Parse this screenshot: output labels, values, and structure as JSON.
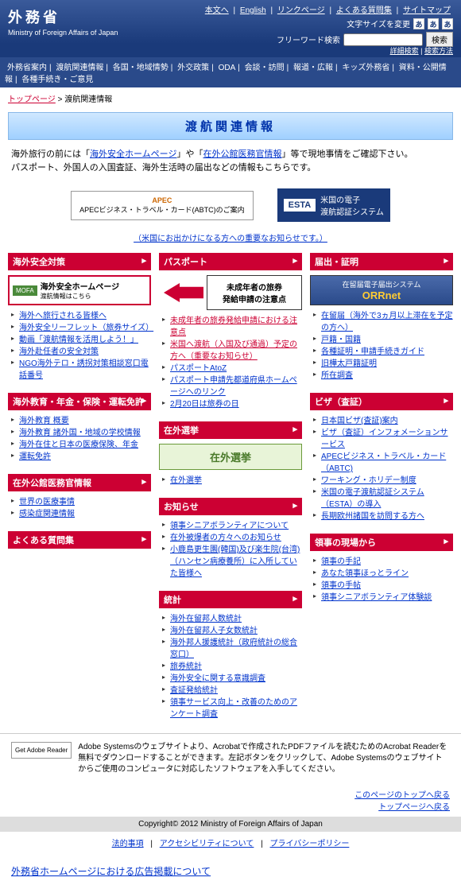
{
  "header": {
    "logo": "外務省",
    "logo_sub": "Ministry of Foreign Affairs of Japan",
    "top_links": [
      "本文へ",
      "English",
      "リンクページ",
      "よくある質問集",
      "サイトマップ"
    ],
    "font_label": "文字サイズを変更",
    "search_label": "フリーワード検索",
    "search_btn": "検索",
    "search_sub": [
      "詳細検索",
      "検索方法"
    ]
  },
  "nav": [
    "外務省案内",
    "渡航関連情報",
    "各国・地域情勢",
    "外交政策",
    "ODA",
    "会談・訪問",
    "報道・広報",
    "キッズ外務省",
    "資料・公開情報",
    "各種手続き・ご意見"
  ],
  "breadcrumb": {
    "home": "トップページ",
    "sep": " > ",
    "cur": "渡航関連情報"
  },
  "title": "渡航関連情報",
  "intro": {
    "l1a": "海外旅行の前には「",
    "l1b": "海外安全ホームページ",
    "l1c": "」や「",
    "l1d": "在外公館医務官情報",
    "l1e": "」等で現地事情をご確認下さい。",
    "l2": "パスポート、外国人の入国査証、海外生活時の届出などの情報もこちらです。"
  },
  "apec": {
    "t": "APEC",
    "s": "APECビジネス・トラベル・カード(ABTC)のご案内"
  },
  "esta": {
    "logo": "ESTA",
    "t1": "米国の電子",
    "t2": "渡航認証システム"
  },
  "notice_center": "（米国にお出かけになる方への重要なお知らせです。）",
  "cols": {
    "c1": {
      "s1": {
        "h": "海外安全対策",
        "box": {
          "tag": "MOFA",
          "t1": "海外安全ホームページ",
          "t2": "渡航情報はこちら"
        },
        "items": [
          "海外へ旅行される皆様へ",
          "海外安全リーフレット（旅券サイズ）",
          "動画「渡航情報を活用しよう！」",
          "海外赴任者の安全対策",
          "NGO海外テロ・誘拐対策相談窓口電話番号"
        ]
      },
      "s2": {
        "h": "海外教育・年金・保険・運転免許",
        "items": [
          "海外教育 概要",
          "海外教育 諸外国・地域の学校情報",
          "海外在住と日本の医療保険、年金",
          "運転免許"
        ]
      },
      "s3": {
        "h": "在外公館医務官情報",
        "items": [
          "世界の医療事情",
          "感染症関連情報"
        ]
      },
      "s4": {
        "h": "よくある質問集"
      }
    },
    "c2": {
      "s1": {
        "h": "パスポート",
        "box": {
          "t1": "未成年者の旅券",
          "t2": "発給申請の注意点"
        },
        "items": [
          {
            "t": "未成年者の旅券発給申請における注意点",
            "red": true
          },
          {
            "t": "米国へ渡航（入国及び通過）予定の方へ（重要なお知らせ）",
            "red": true
          },
          {
            "t": "パスポートAtoZ"
          },
          {
            "t": "パスポート申請先都道府県ホームページへのリンク"
          },
          {
            "t": "2月20日は旅券の日"
          }
        ]
      },
      "s2": {
        "h": "在外選挙",
        "box": "在外選挙",
        "items": [
          "在外選挙"
        ]
      },
      "s3": {
        "h": "お知らせ",
        "items": [
          "領事シニアボランティアについて",
          "在外被爆者の方々へのお知らせ",
          "小鹿島更生園(韓国)及び楽生院(台湾)（ハンセン病療養所）に入所していた皆様へ"
        ]
      },
      "s4": {
        "h": "統計",
        "items": [
          "海外在留邦人数統計",
          "海外在留邦人子女数統計",
          "海外邦人援護統計（政府統計の総合窓口）",
          "旅券統計",
          "海外安全に関する意識調査",
          "査証発給統計",
          "領事サービス向上・改善のためのアンケート調査"
        ]
      }
    },
    "c3": {
      "s1": {
        "h": "届出・証明",
        "box": {
          "sm": "在留届電子届出システム",
          "t": "ORRnet"
        },
        "items": [
          "在留届（海外で3ヵ月以上滞在を予定の方へ）",
          "戸籍・国籍",
          "各種証明・申請手続きガイド",
          "旧樺太戸籍証明",
          "所在調査"
        ]
      },
      "s2": {
        "h": "ビザ（査証）",
        "items": [
          "日本国ビザ(査証)案内",
          "ビザ（査証）インフォメーションサービス",
          "APECビジネス・トラベル・カード（ABTC)",
          "ワーキング・ホリデー制度",
          "米国の電子渡航認証システム（ESTA）の導入",
          "長期欧州諸国を訪問する方へ"
        ]
      },
      "s3": {
        "h": "領事の現場から",
        "items": [
          "領事の手記",
          "あなた領事ほっとライン",
          "領事の手帖",
          "領事シニアボランティア体験談"
        ]
      }
    }
  },
  "reader": {
    "badge": "Get Adobe Reader",
    "text": "Adobe Systemsのウェブサイトより、Acrobatで作成されたPDFファイルを読むためのAcrobat Readerを無料でダウンロードすることができます。左記ボタンをクリックして、Adobe Systemsのウェブサイトからご使用のコンピュータに対応したソフトウェアを入手してください。"
  },
  "footer_links": [
    "このページのトップへ戻る",
    "トップページへ戻る"
  ],
  "copyright": "Copyright© 2012 Ministry of Foreign Affairs of Japan",
  "copy_links": [
    "法的事項",
    "アクセシビリティについて",
    "プライバシーポリシー"
  ],
  "ad": "外務省ホームページにおける広告掲載について"
}
